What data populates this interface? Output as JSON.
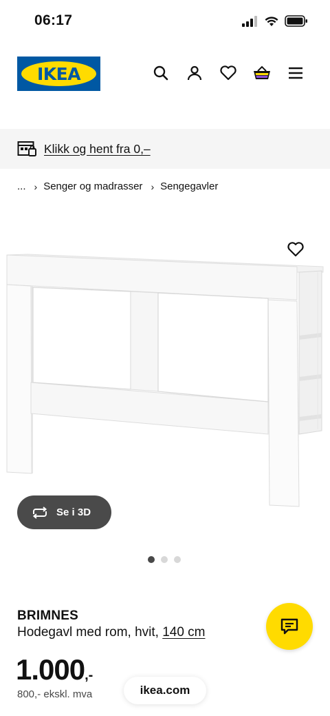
{
  "status_bar": {
    "time": "06:17"
  },
  "header": {
    "logo_text": "IKEA",
    "icons": [
      "search-icon",
      "account-icon",
      "heart-icon",
      "basket-icon",
      "menu-icon"
    ]
  },
  "promo": {
    "icon": "store-icon",
    "label": "Klikk og hent fra 0,–"
  },
  "breadcrumb": {
    "ellipsis": "...",
    "items": [
      "Senger og madrasser",
      "Sengegavler"
    ]
  },
  "image_viewer": {
    "view_3d_label": "Se i 3D",
    "image_count": 3,
    "active_index": 0
  },
  "product": {
    "name": "BRIMNES",
    "description": "Hodegavl med rom, hvit, ",
    "size": "140 cm",
    "price_main": "1.000",
    "price_suffix": ",-",
    "price_ex_vat": "800,- ekskl. mva"
  },
  "browser": {
    "url": "ikea.com"
  },
  "colors": {
    "ikea_blue": "#0058a3",
    "ikea_yellow": "#ffdb00"
  }
}
